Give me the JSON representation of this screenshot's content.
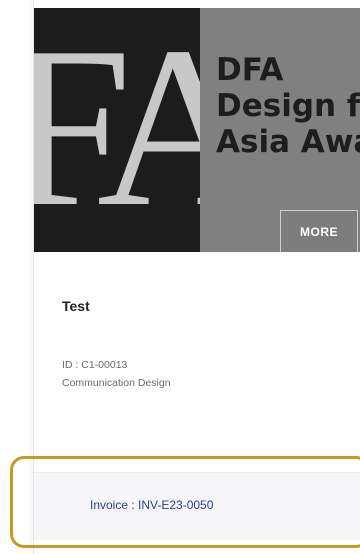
{
  "banner": {
    "logo_text": "FA",
    "lines": [
      "DFA",
      "Design fo",
      "Asia Awa"
    ],
    "more_label": "MORE"
  },
  "item": {
    "title": "Test",
    "id_text": "ID : C1-00013",
    "category": "Communication Design"
  },
  "footer": {
    "invoice_text": "Invoice : INV-E23-0050"
  },
  "colors": {
    "banner_bg": "#808080",
    "logo_bg": "#1c1c1c",
    "invoice_link": "#2f3a8f",
    "highlight_border": "#c79b1c"
  }
}
